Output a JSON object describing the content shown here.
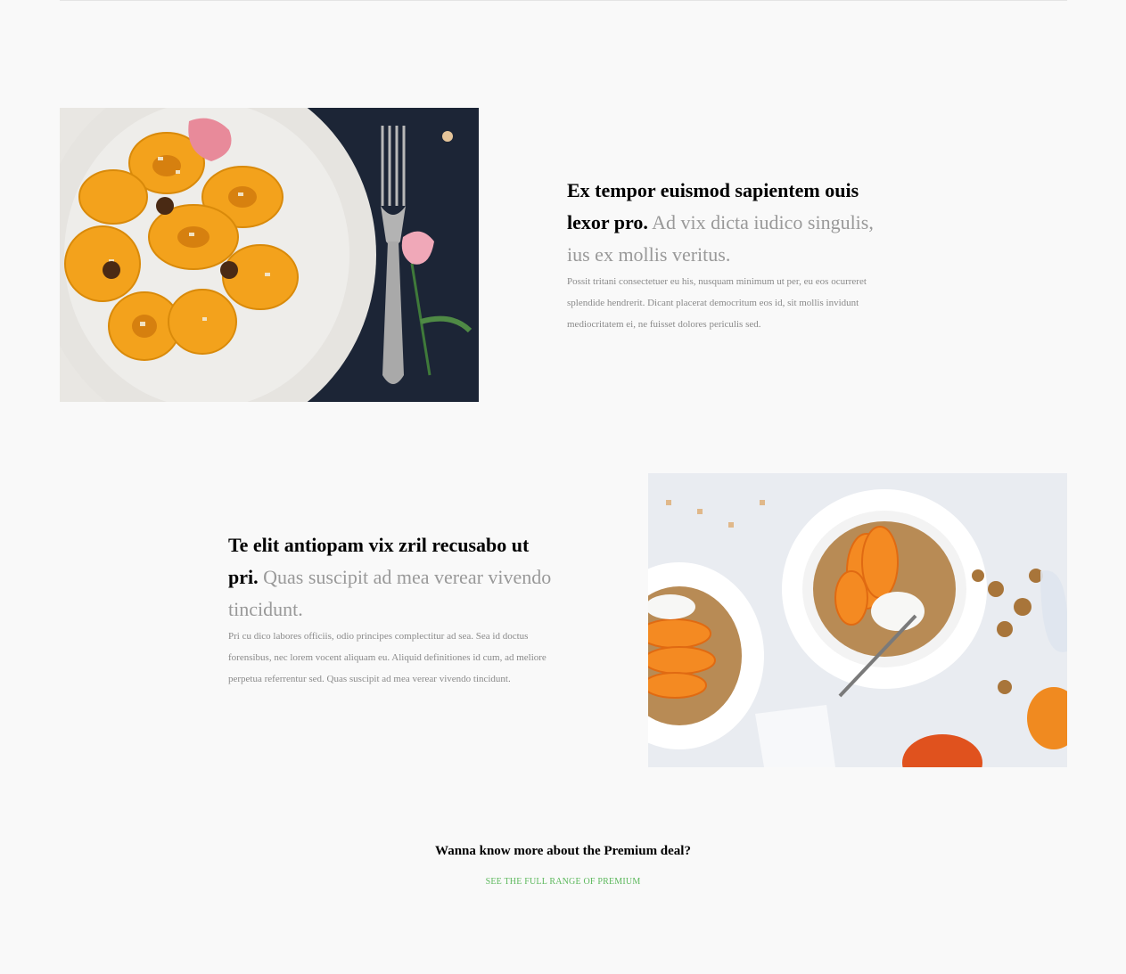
{
  "features": [
    {
      "headline_bold": "Ex tempor euismod sapientem ouis lexor pro.",
      "headline_light": "Ad vix dicta iudico singulis, ius ex mollis veritus.",
      "body": "Possit tritani consectetuer eu his, nusquam minimum ut per, eu eos ocurreret splendide hendrerit. Dicant placerat democritum eos id, sit mollis invidunt mediocritatem ei, ne fuisset dolores periculis sed."
    },
    {
      "headline_bold": "Te elit antiopam vix zril recusabo ut pri.",
      "headline_light": "Quas suscipit ad mea verear vivendo tincidunt.",
      "body": "Pri cu dico labores officiis, odio principes complectitur ad sea. Sea id doctus forensibus, nec lorem vocent aliquam eu. Aliquid definitiones id cum, ad meliore perpetua referrentur sed. Quas suscipit ad mea verear vivendo tincidunt."
    }
  ],
  "cta": {
    "title": "Wanna know more about the Premium deal?",
    "link_label": "SEE THE FULL RANGE OF PREMIUM"
  },
  "colors": {
    "background": "#f9f9f9",
    "link": "#5cb85c",
    "muted_text": "#999999"
  }
}
